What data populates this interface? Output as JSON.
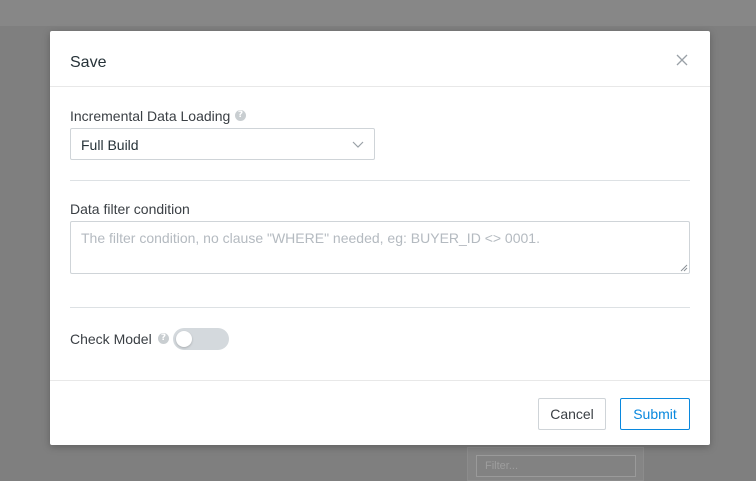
{
  "background": {
    "filter_placeholder": "Filter..."
  },
  "modal": {
    "title": "Save",
    "close_icon": "close-icon",
    "incremental": {
      "label": "Incremental Data Loading",
      "help_icon": "help-icon",
      "help_glyph": "?",
      "selected": "Full Build",
      "dropdown_icon": "chevron-down-icon"
    },
    "filter": {
      "label": "Data filter condition",
      "placeholder": "The filter condition, no clause \"WHERE\" needed, eg: BUYER_ID <> 0001."
    },
    "check_model": {
      "label": "Check Model",
      "help_icon": "help-icon",
      "help_glyph": "?",
      "enabled": false
    },
    "footer": {
      "cancel_label": "Cancel",
      "submit_label": "Submit"
    }
  },
  "colors": {
    "overlay": "#7f7f7f",
    "accent": "#0988de",
    "text": "#263238",
    "placeholder": "#b4bac0",
    "toggle_off": "#d4d9dd"
  }
}
